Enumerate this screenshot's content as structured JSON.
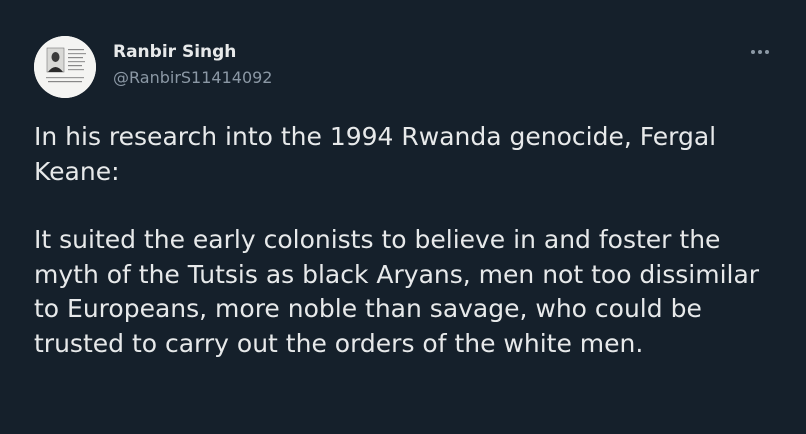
{
  "tweet": {
    "author_name": "Ranbir Singh",
    "author_handle": "@RanbirS11414092",
    "more_icon": "more-horizontal-icon",
    "paragraphs": [
      "In his research into the 1994 Rwanda genocide, Fergal Keane:",
      "It suited the early colonists to believe in and foster the myth of the Tutsis as black Aryans, men not too dissimilar to Europeans, more noble than savage, who could be trusted to carry out the orders of the white men."
    ]
  },
  "colors": {
    "background": "#15202b",
    "text_primary": "#e7e9ea",
    "text_secondary": "#8b98a5"
  }
}
